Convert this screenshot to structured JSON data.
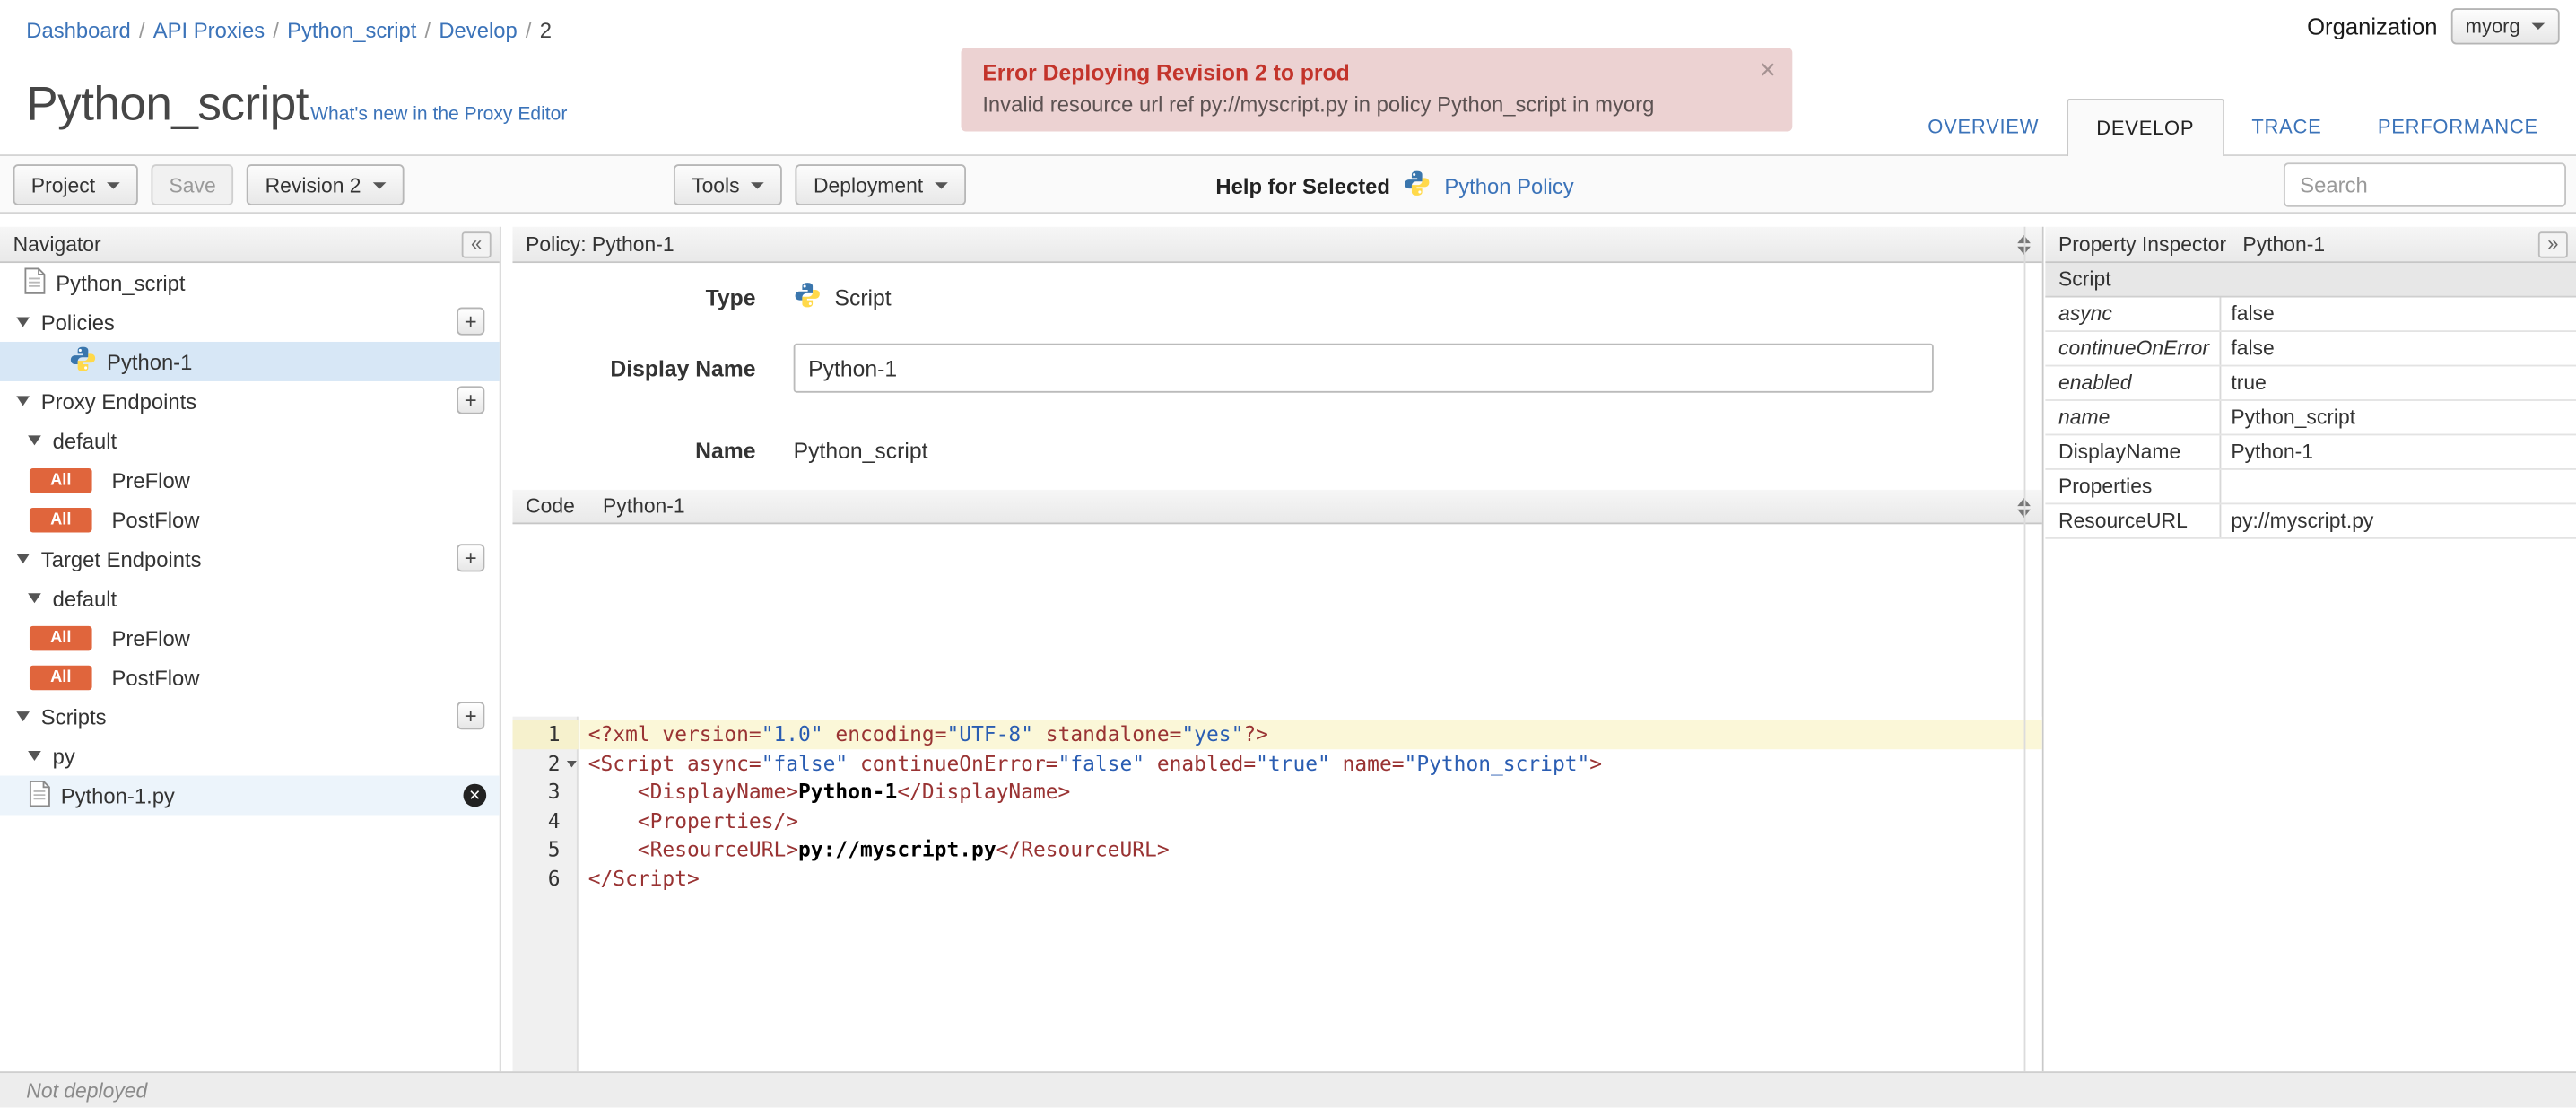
{
  "breadcrumb": {
    "items": [
      "Dashboard",
      "API Proxies",
      "Python_script",
      "Develop",
      "2"
    ],
    "separator": "/"
  },
  "organization": {
    "label": "Organization",
    "value": "myorg"
  },
  "error_banner": {
    "title": "Error Deploying Revision 2 to prod",
    "message": "Invalid resource url ref py://myscript.py in policy Python_script in myorg",
    "close_label": "×"
  },
  "page": {
    "title": "Python_script",
    "whats_new_link": "What's new in the Proxy Editor"
  },
  "tabs": [
    {
      "label": "OVERVIEW"
    },
    {
      "label": "DEVELOP"
    },
    {
      "label": "TRACE"
    },
    {
      "label": "PERFORMANCE"
    }
  ],
  "toolbar": {
    "project_button": "Project",
    "save_button": "Save",
    "revision_button": "Revision 2",
    "tools_button": "Tools",
    "deployment_button": "Deployment",
    "help_for_selected_label": "Help for Selected",
    "help_link": "Python Policy",
    "search_placeholder": "Search"
  },
  "navigator": {
    "title": "Navigator",
    "collapse_icon": "«",
    "root_item": "Python_script",
    "policies": {
      "label": "Policies",
      "selected_item": "Python-1"
    },
    "proxy_endpoints": {
      "label": "Proxy Endpoints",
      "group": "default",
      "flows": [
        {
          "badge": "All",
          "label": "PreFlow"
        },
        {
          "badge": "All",
          "label": "PostFlow"
        }
      ]
    },
    "target_endpoints": {
      "label": "Target Endpoints",
      "group": "default",
      "flows": [
        {
          "badge": "All",
          "label": "PreFlow"
        },
        {
          "badge": "All",
          "label": "PostFlow"
        }
      ]
    },
    "scripts": {
      "label": "Scripts",
      "group": "py",
      "file": "Python-1.py"
    }
  },
  "policy_panel": {
    "title": "Policy: Python-1",
    "form": {
      "type_label": "Type",
      "type_value": "Script",
      "display_name_label": "Display Name",
      "display_name_value": "Python-1",
      "name_label": "Name",
      "name_value": "Python_script"
    },
    "code": {
      "label": "Code",
      "policy_name": "Python-1",
      "lines": [
        {
          "n": 1,
          "hl": true,
          "fold": false,
          "tokens": [
            [
              "m",
              "<?xml version="
            ],
            [
              "v",
              "\"1.0\""
            ],
            [
              "m",
              " encoding="
            ],
            [
              "v",
              "\"UTF-8\""
            ],
            [
              "m",
              " standalone="
            ],
            [
              "v",
              "\"yes\""
            ],
            [
              "m",
              "?>"
            ]
          ]
        },
        {
          "n": 2,
          "hl": false,
          "fold": true,
          "tokens": [
            [
              "m",
              "<Script async="
            ],
            [
              "v",
              "\"false\""
            ],
            [
              "m",
              " continueOnError="
            ],
            [
              "v",
              "\"false\""
            ],
            [
              "m",
              " enabled="
            ],
            [
              "v",
              "\"true\""
            ],
            [
              "m",
              " name="
            ],
            [
              "v",
              "\"Python_script\""
            ],
            [
              "m",
              ">"
            ]
          ]
        },
        {
          "n": 3,
          "hl": false,
          "fold": false,
          "tokens": [
            [
              "m",
              "    <DisplayName>"
            ],
            [
              "t",
              "Python-1"
            ],
            [
              "m",
              "</DisplayName>"
            ]
          ]
        },
        {
          "n": 4,
          "hl": false,
          "fold": false,
          "tokens": [
            [
              "m",
              "    <Properties/>"
            ]
          ]
        },
        {
          "n": 5,
          "hl": false,
          "fold": false,
          "tokens": [
            [
              "m",
              "    <ResourceURL>"
            ],
            [
              "t",
              "py://myscript.py"
            ],
            [
              "m",
              "</ResourceURL>"
            ]
          ]
        },
        {
          "n": 6,
          "hl": false,
          "fold": false,
          "tokens": [
            [
              "m",
              "</Script>"
            ]
          ]
        }
      ]
    }
  },
  "property_inspector": {
    "title": "Property Inspector",
    "subtitle": "Python-1",
    "expand_icon": "»",
    "section": "Script",
    "rows": [
      {
        "key": "async",
        "value": "false",
        "italic": true
      },
      {
        "key": "continueOnError",
        "value": "false",
        "italic": true
      },
      {
        "key": "enabled",
        "value": "true",
        "italic": true
      },
      {
        "key": "name",
        "value": "Python_script",
        "italic": true
      },
      {
        "key": "DisplayName",
        "value": "Python-1",
        "italic": false
      },
      {
        "key": "Properties",
        "value": "",
        "italic": false
      },
      {
        "key": "ResourceURL",
        "value": "py://myscript.py",
        "italic": false
      }
    ]
  },
  "status_bar": {
    "text": "Not deployed"
  }
}
